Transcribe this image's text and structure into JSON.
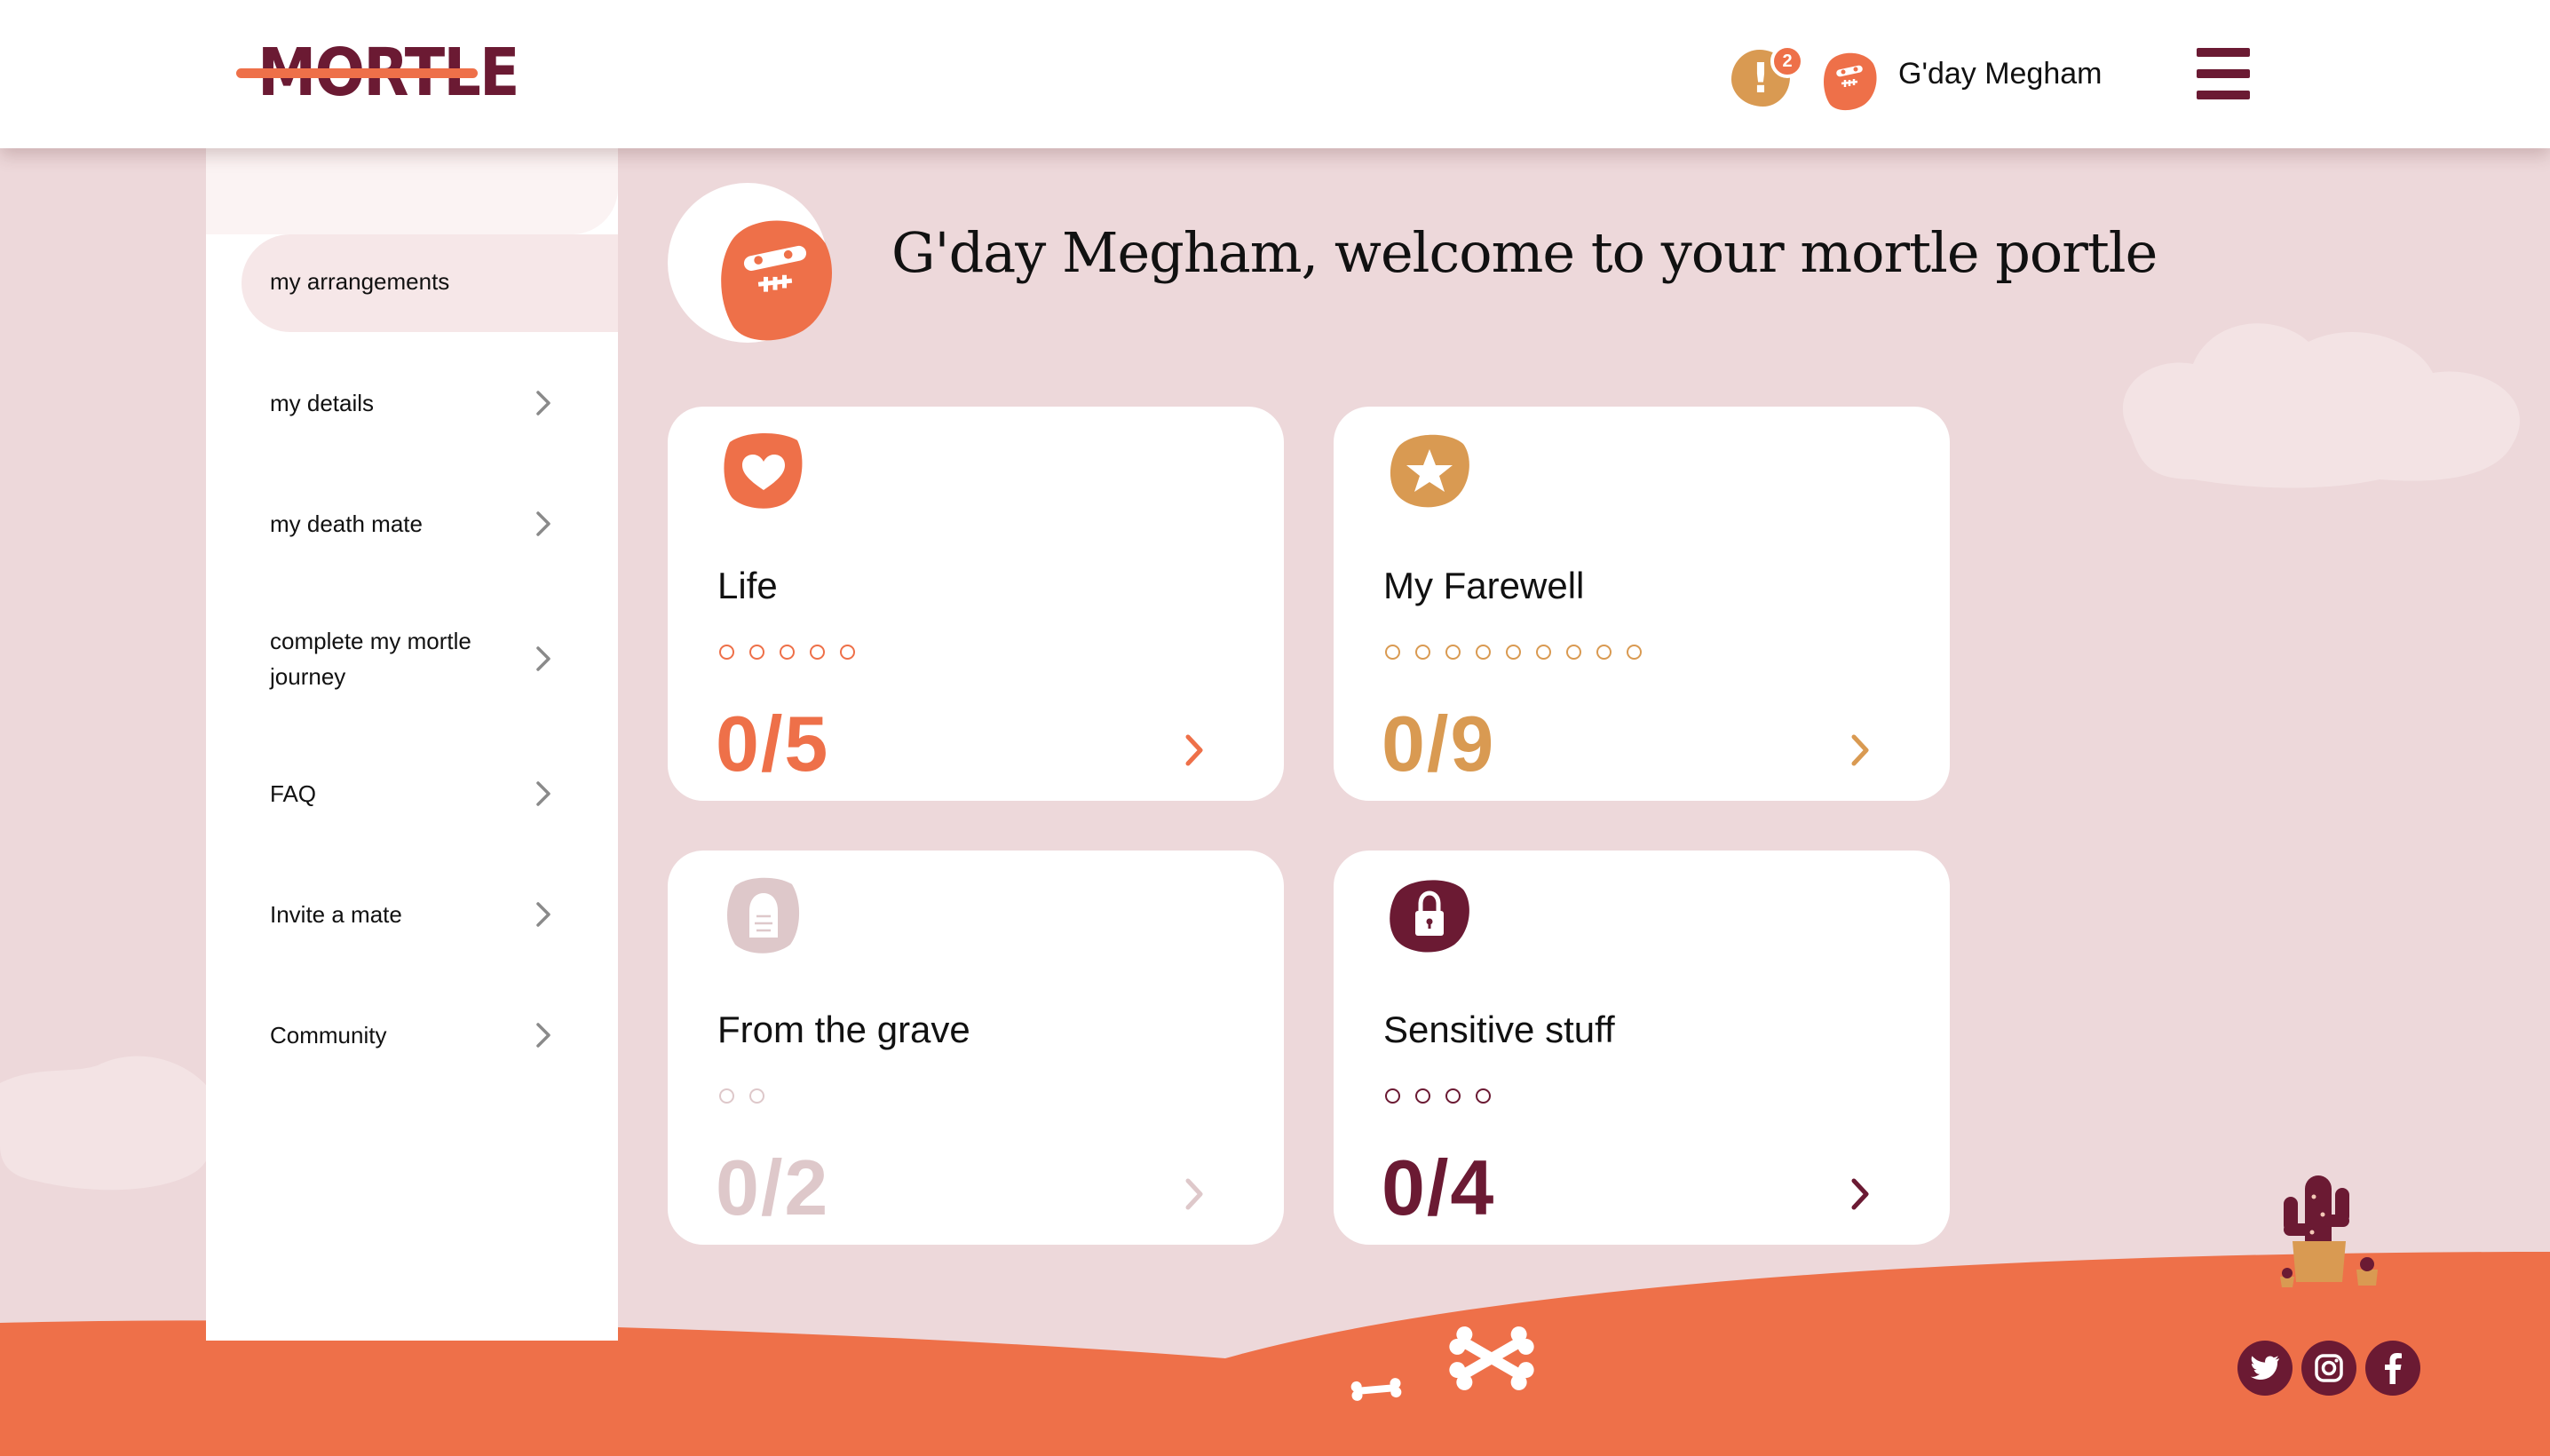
{
  "header": {
    "logo_text": "MORTLE",
    "notification_icon": "exclamation-icon",
    "notification_count": "2",
    "avatar_icon": "skull-avatar-icon",
    "greeting": "G'day Megham",
    "menu_icon": "hamburger-menu-icon"
  },
  "sidebar": {
    "items": [
      {
        "label": "my arrangements",
        "active": true
      },
      {
        "label": "my details",
        "active": false
      },
      {
        "label": "my death mate",
        "active": false
      },
      {
        "label": "complete my mortle journey",
        "active": false
      },
      {
        "label": "FAQ",
        "active": false
      },
      {
        "label": "Invite a mate",
        "active": false
      },
      {
        "label": "Community",
        "active": false
      }
    ]
  },
  "main": {
    "welcome_title": "G'day Megham, welcome to your mortle portle",
    "cards": [
      {
        "title": "Life",
        "progress": "0/5",
        "completed": 0,
        "total": 5,
        "icon": "heart-icon",
        "color": "#ee7049"
      },
      {
        "title": "My Farewell",
        "progress": "0/9",
        "completed": 0,
        "total": 9,
        "icon": "star-icon",
        "color": "#d99a52"
      },
      {
        "title": "From the grave",
        "progress": "0/2",
        "completed": 0,
        "total": 2,
        "icon": "tombstone-icon",
        "color": "#dec8ca"
      },
      {
        "title": "Sensitive stuff",
        "progress": "0/4",
        "completed": 0,
        "total": 4,
        "icon": "padlock-icon",
        "color": "#6b1a33"
      }
    ]
  },
  "footer": {
    "social": [
      "twitter-icon",
      "instagram-icon",
      "facebook-icon"
    ]
  },
  "colors": {
    "brand_maroon": "#6b1a33",
    "brand_orange": "#ee7049",
    "brand_gold": "#d99a52",
    "background_pink": "#edd8da"
  }
}
